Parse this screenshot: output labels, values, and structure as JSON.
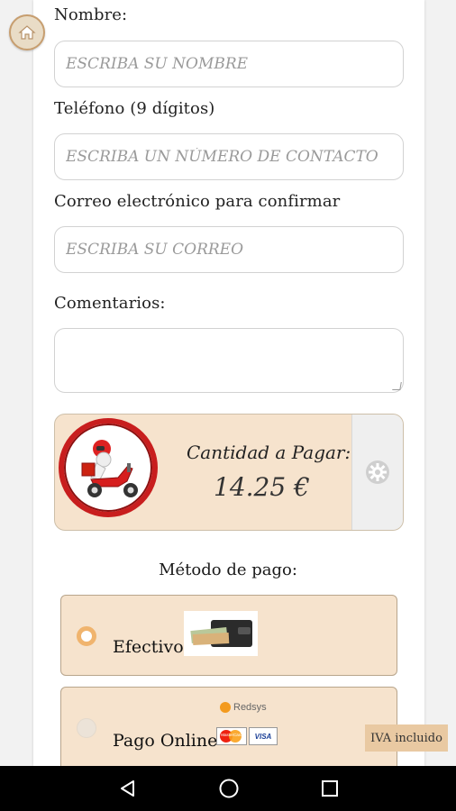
{
  "form": {
    "name_label": "Nombre:",
    "name_placeholder": "ESCRIBA SU NOMBRE",
    "phone_label": "Teléfono (9 dígitos)",
    "phone_placeholder": "ESCRIBA UN NÚMERO DE CONTACTO",
    "email_label": "Correo electrónico para confirmar",
    "email_placeholder": "ESCRIBA SU CORREO",
    "comments_label": "Comentarios:"
  },
  "payment": {
    "amount_label": "Cantidad a Pagar:",
    "amount_value": "14.25 €",
    "method_title": "Método de pago:",
    "methods": [
      {
        "label": "Efectivo",
        "selected": true
      },
      {
        "label": "Pago Online",
        "selected": false
      }
    ],
    "redsys_text": "Redsys",
    "mastercard_text": "MasterCard",
    "visa_text": "VISA"
  },
  "badge": {
    "iva": "IVA incluido"
  },
  "icons": {
    "home": "home-icon",
    "settings": "gear-icon",
    "delivery": "scooter-delivery-icon",
    "cash": "wallet-cash-icon",
    "nav_back": "back-triangle-icon",
    "nav_home": "home-circle-icon",
    "nav_recent": "recent-square-icon"
  },
  "colors": {
    "panel_bg": "#f6e3cd",
    "panel_border": "#b8a58c",
    "accent_red": "#c81e1e",
    "radio_selected": "#f0b46e",
    "badge_bg": "#e9c9a2"
  }
}
